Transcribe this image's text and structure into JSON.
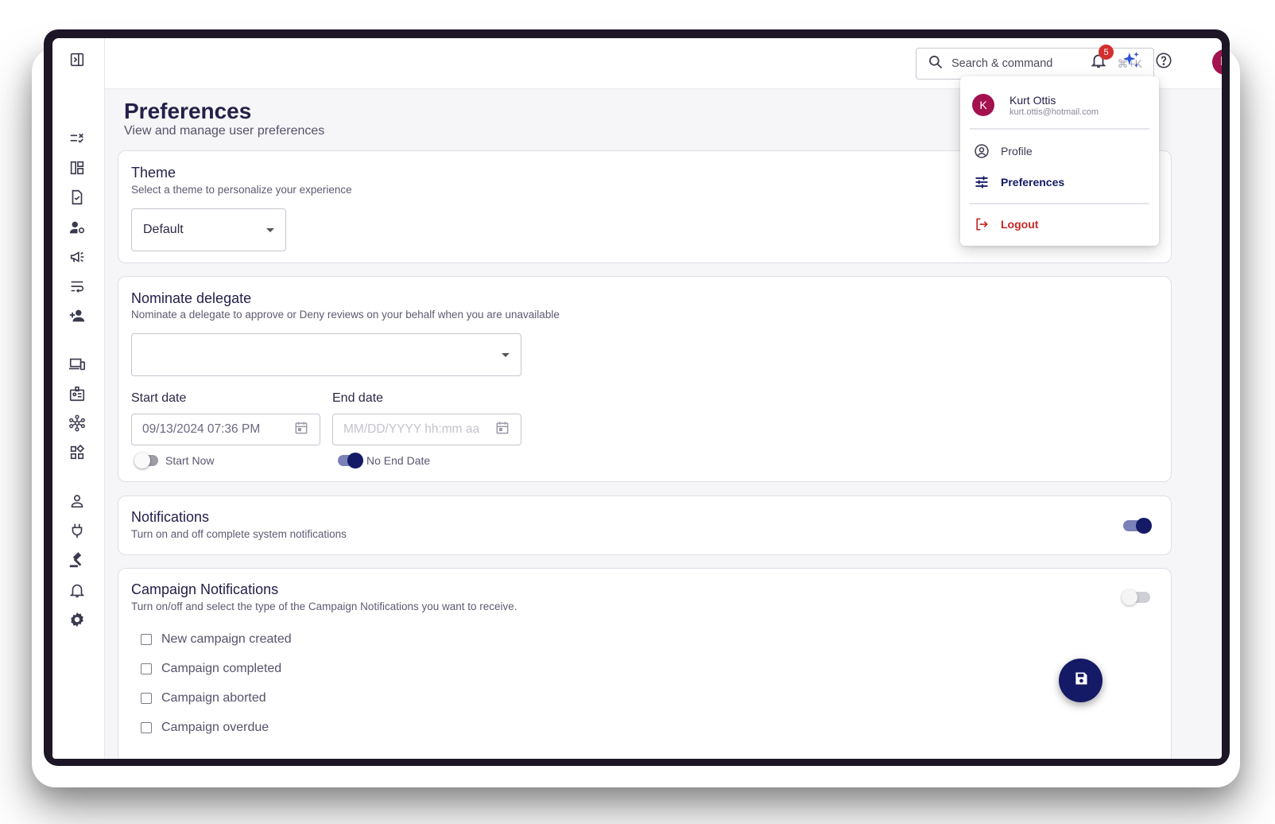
{
  "header": {
    "search_placeholder": "Search & command",
    "search_shortcut": "⌘+K",
    "notification_count": "5",
    "avatar_initial": "K"
  },
  "page": {
    "title": "Preferences",
    "subtitle": "View and manage user preferences"
  },
  "theme": {
    "title": "Theme",
    "description": "Select a theme to personalize your experience",
    "selected": "Default"
  },
  "delegate": {
    "title": "Nominate delegate",
    "description": "Nominate a delegate to approve or Deny reviews on your behalf when you are unavailable",
    "selected": "",
    "start_label": "Start date",
    "start_value": "09/13/2024 07:36 PM",
    "end_label": "End date",
    "end_placeholder": "MM/DD/YYYY hh:mm aa",
    "start_now_label": "Start Now",
    "start_now_on": false,
    "no_end_date_label": "No End Date",
    "no_end_date_on": true
  },
  "notifications": {
    "title": "Notifications",
    "description": "Turn on and off complete system notifications",
    "enabled": true
  },
  "campaign": {
    "title": "Campaign Notifications",
    "description": "Turn on/off and select the type of the Campaign Notifications you want to receive.",
    "enabled": false,
    "options": [
      {
        "label": "New campaign created",
        "checked": false
      },
      {
        "label": "Campaign completed",
        "checked": false
      },
      {
        "label": "Campaign aborted",
        "checked": false
      },
      {
        "label": "Campaign overdue",
        "checked": false
      }
    ]
  },
  "user_menu": {
    "avatar_initial": "K",
    "name": "Kurt Ottis",
    "email": "kurt.ottis@hotmail.com",
    "items": [
      {
        "label": "Profile",
        "icon": "account-circle-icon"
      },
      {
        "label": "Preferences",
        "icon": "tune-icon",
        "active": true
      },
      {
        "label": "Logout",
        "icon": "logout-icon"
      }
    ]
  },
  "colors": {
    "primary": "#141a66",
    "avatar": "#a4114f",
    "logout": "#c62828",
    "badge": "#d32f2f",
    "sparkle": "#2f55d4"
  },
  "sidebar_icons": [
    "sidebar-toggle-icon",
    "checklist-icon",
    "dashboard-icon",
    "task-icon",
    "user-settings-icon",
    "campaign-icon",
    "wrap-text-icon",
    "add-user-icon",
    "devices-icon",
    "badge-icon",
    "network-icon",
    "widgets-icon",
    "person-icon",
    "plug-icon",
    "gavel-icon",
    "bell-icon",
    "gear-icon"
  ]
}
